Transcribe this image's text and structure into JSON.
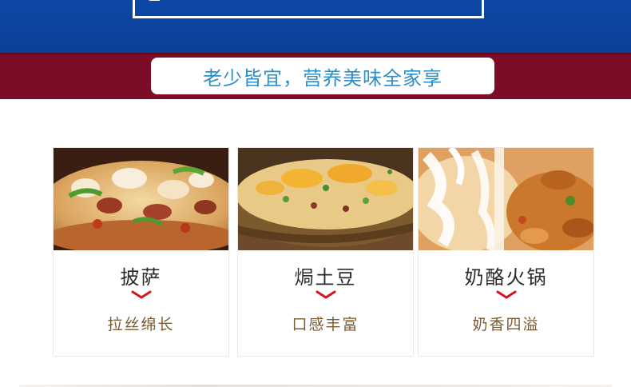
{
  "banner": {
    "slogan": "老少皆宜，营养美味全家享",
    "colors": {
      "blue": "#0d48a6",
      "maroon": "#7d0c27",
      "slogan_text": "#2d8fc7"
    }
  },
  "cards": [
    {
      "title": "披萨",
      "subtitle": "拉丝绵长",
      "image": "pizza-photo"
    },
    {
      "title": "焗土豆",
      "subtitle": "口感丰富",
      "image": "baked-potato-photo"
    },
    {
      "title": "奶酪火锅",
      "subtitle": "奶香四溢",
      "image": "cheese-hotpot-photo"
    }
  ],
  "accent": {
    "chevron": "#d0151f",
    "subtitle_text": "#7a5a30"
  }
}
